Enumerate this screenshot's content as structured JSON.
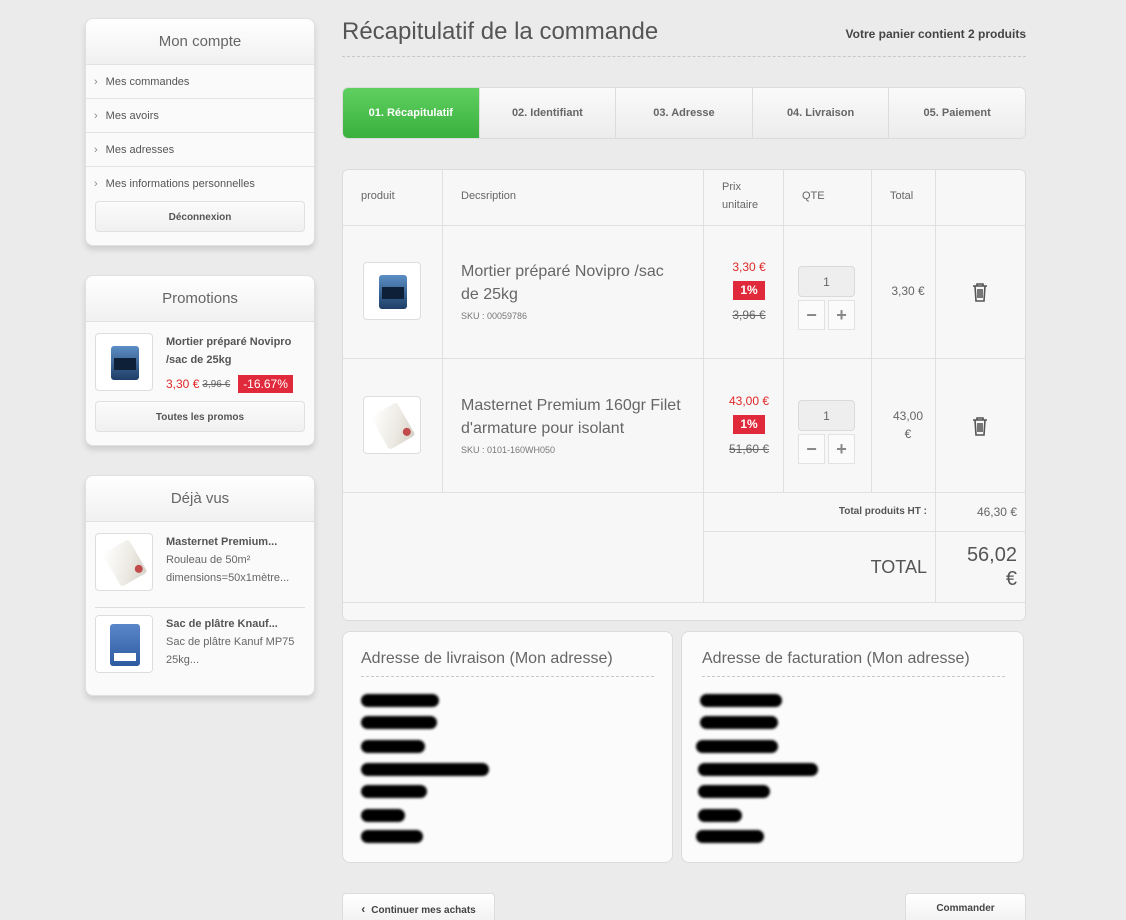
{
  "account": {
    "title": "Mon compte",
    "items": [
      {
        "label": "Mes commandes"
      },
      {
        "label": "Mes avoirs"
      },
      {
        "label": "Mes adresses"
      },
      {
        "label": "Mes informations personnelles"
      }
    ],
    "logout_label": "Déconnexion"
  },
  "promotions": {
    "title": "Promotions",
    "product": {
      "name_line1": "Mortier préparé Novipro",
      "name_line2": "/sac de 25kg",
      "price": "3,30 €",
      "old_price": "3,96 €",
      "discount": "-16.67%"
    },
    "all_label": "Toutes les promos"
  },
  "seen": {
    "title": "Déjà vus",
    "items": [
      {
        "name": "Masternet Premium...",
        "desc1": "Rouleau de 50m²",
        "desc2": "dimensions=50x1mètre..."
      },
      {
        "name": "Sac de plâtre Knauf...",
        "desc1": "Sac de plâtre Kanuf MP75",
        "desc2": "25kg..."
      }
    ]
  },
  "header": {
    "title": "Récapitulatif de la commande",
    "cart_count": "Votre panier contient 2 produits"
  },
  "steps": [
    {
      "label": "01. Récapitulatif",
      "active": true
    },
    {
      "label": "02. Identifiant",
      "active": false
    },
    {
      "label": "03. Adresse",
      "active": false
    },
    {
      "label": "04. Livraison",
      "active": false
    },
    {
      "label": "05. Paiement",
      "active": false
    }
  ],
  "table": {
    "headers": {
      "product": "produit",
      "description": "Decsription",
      "unit_price_1": "Prix",
      "unit_price_2": "unitaire",
      "qty": "QTE",
      "total": "Total"
    },
    "rows": [
      {
        "name_line1": "Mortier préparé Novipro /sac",
        "name_line2": "de 25kg",
        "sku": "SKU : 00059786",
        "price": "3,30 €",
        "badge": "1%",
        "old_price": "3,96 €",
        "qty": "1",
        "total_line1": "3,30 €",
        "total_line2": ""
      },
      {
        "name_line1": "Masternet Premium 160gr Filet",
        "name_line2": "d'armature pour isolant",
        "sku": "SKU : 0101-160WH050",
        "price": "43,00 €",
        "badge": "1%",
        "old_price": "51,60 €",
        "qty": "1",
        "total_line1": "43,00",
        "total_line2": "€"
      }
    ],
    "qty_minus": "−",
    "qty_plus": "+",
    "subtotal_label": "Total produits HT :",
    "subtotal_value": "46,30 €",
    "total_label": "TOTAL",
    "total_value_line1": "56,02",
    "total_value_line2": "€"
  },
  "addresses": {
    "delivery_title": "Adresse de livraison (Mon adresse)",
    "billing_title": "Adresse de facturation (Mon adresse)"
  },
  "buttons": {
    "continue": "Continuer mes achats",
    "order": "Commander"
  }
}
